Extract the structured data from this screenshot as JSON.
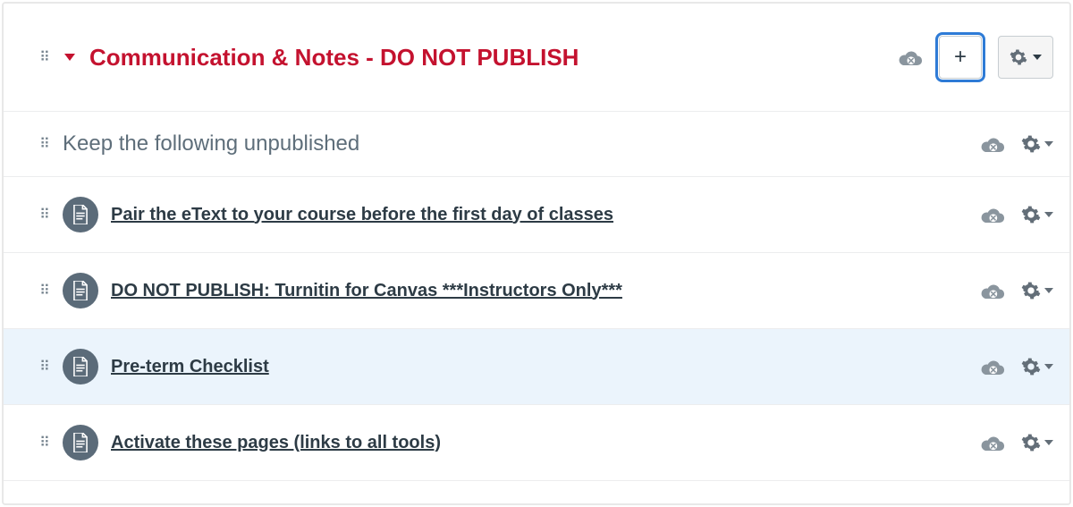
{
  "module": {
    "title": "Communication & Notes - DO NOT PUBLISH"
  },
  "subheader": {
    "label": "Keep the following unpublished"
  },
  "items": [
    {
      "title": "Pair the eText to your course before the first day of classes",
      "highlight": false
    },
    {
      "title": "DO NOT PUBLISH: Turnitin for Canvas ***Instructors Only***",
      "highlight": false
    },
    {
      "title": "Pre-term Checklist",
      "highlight": true
    },
    {
      "title": "Activate these pages (links to all tools)",
      "highlight": false
    }
  ],
  "icons": {
    "drag": "⠿",
    "plus": "+"
  }
}
